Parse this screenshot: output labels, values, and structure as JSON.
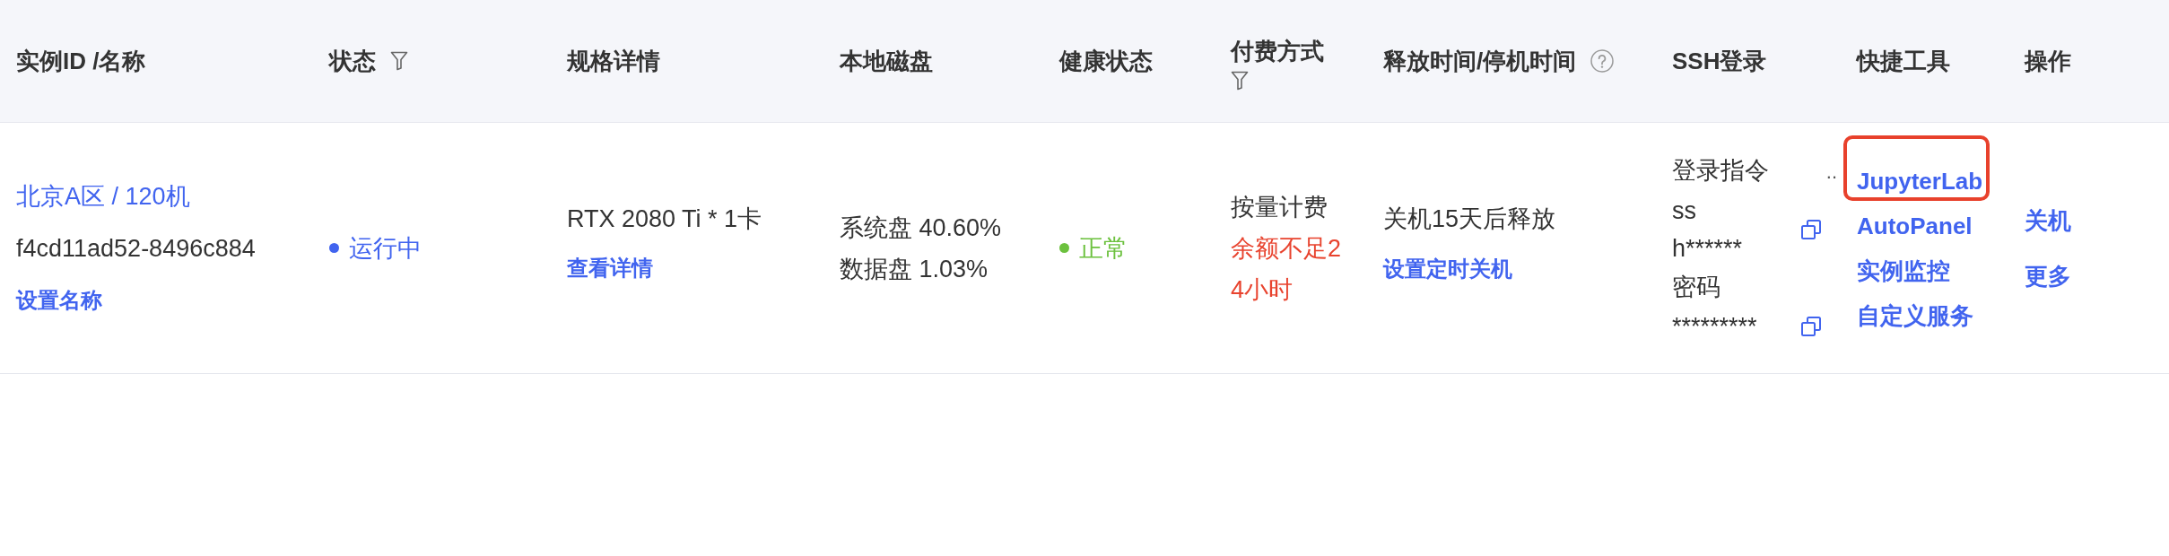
{
  "table": {
    "columns": [
      {
        "label": "实例ID /名称",
        "filter": false,
        "help": false
      },
      {
        "label": "状态",
        "filter": true,
        "help": false
      },
      {
        "label": "规格详情",
        "filter": false,
        "help": false
      },
      {
        "label": "本地磁盘",
        "filter": false,
        "help": false
      },
      {
        "label": "健康状态",
        "filter": false,
        "help": false
      },
      {
        "label": "付费方式",
        "filter": true,
        "help": false
      },
      {
        "label": "释放时间/停机时间",
        "filter": false,
        "help": true
      },
      {
        "label": "SSH登录",
        "filter": false,
        "help": false
      },
      {
        "label": "快捷工具",
        "filter": false,
        "help": false
      },
      {
        "label": "操作",
        "filter": false,
        "help": false
      }
    ],
    "rows": [
      {
        "name": "北京A区 / 120机",
        "instance_id": "f4cd11ad52-8496c884",
        "rename_link": "设置名称",
        "status": {
          "label": "运行中",
          "color": "#4164ef"
        },
        "spec": "RTX 2080 Ti * 1卡",
        "spec_link": "查看详情",
        "disks": [
          "系统盘 40.60%",
          "数据盘 1.03%"
        ],
        "health": {
          "label": "正常",
          "color": "#6cc13e"
        },
        "billing": "按量计费",
        "billing_warning": "余额不足24小时",
        "release": "关机15天后释放",
        "release_link": "设置定时关机",
        "ssh": {
          "command_label": "登录指令",
          "overflow": "..",
          "command_lines": [
            "ss",
            "h******"
          ],
          "password_label": "密码",
          "password": "*********"
        },
        "tools": [
          {
            "label": "JupyterLab",
            "highlighted": true
          },
          {
            "label": "AutoPanel",
            "highlighted": false
          },
          {
            "label": "实例监控",
            "highlighted": false
          },
          {
            "label": "自定义服务",
            "highlighted": false
          }
        ],
        "actions": [
          "关机",
          "更多"
        ]
      }
    ]
  }
}
